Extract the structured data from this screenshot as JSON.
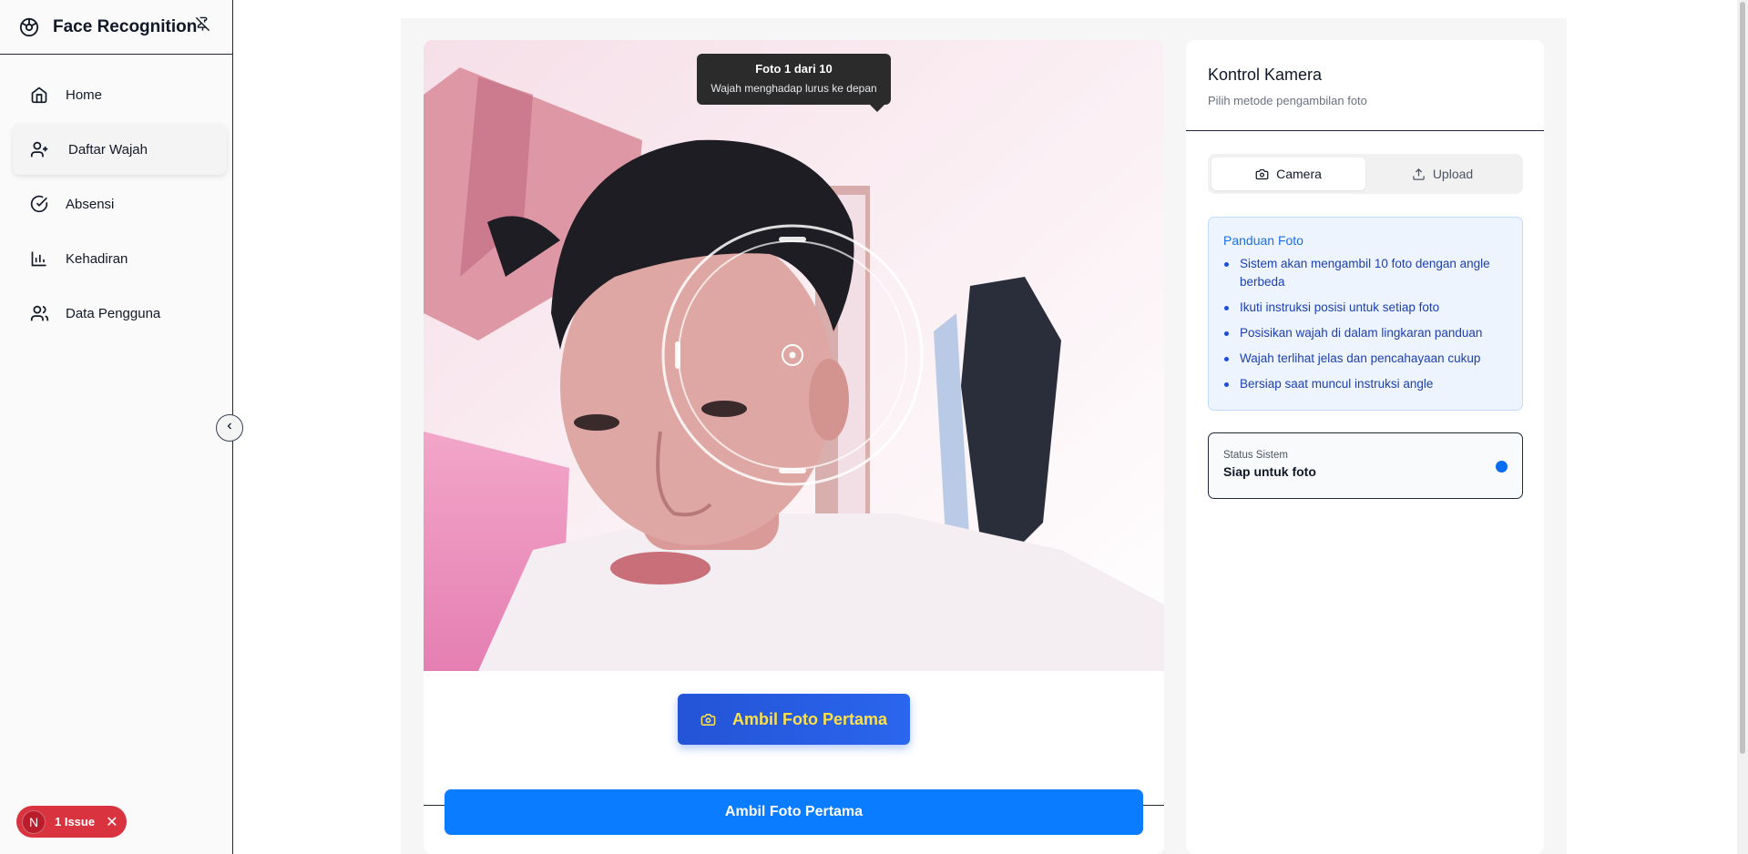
{
  "sidebar": {
    "title": "Face Recognition",
    "items": [
      {
        "label": "Home",
        "icon": "home-icon"
      },
      {
        "label": "Daftar Wajah",
        "icon": "user-plus-icon",
        "active": true
      },
      {
        "label": "Absensi",
        "icon": "check-circle-icon"
      },
      {
        "label": "Kehadiran",
        "icon": "bar-chart-icon"
      },
      {
        "label": "Data Pengguna",
        "icon": "users-icon"
      }
    ]
  },
  "camera": {
    "tooltip_title": "Foto 1 dari 10",
    "tooltip_subtitle": "Wajah menghadap lurus ke depan",
    "capture_label": "Ambil Foto Pertama",
    "primary_label": "Ambil Foto Pertama"
  },
  "control": {
    "title": "Kontrol Kamera",
    "subtitle": "Pilih metode pengambilan foto",
    "tabs": [
      {
        "label": "Camera",
        "icon": "camera-icon",
        "active": true
      },
      {
        "label": "Upload",
        "icon": "upload-icon",
        "active": false
      }
    ],
    "guide": {
      "title": "Panduan Foto",
      "items": [
        "Sistem akan mengambil 10 foto dengan angle berbeda",
        "Ikuti instruksi posisi untuk setiap foto",
        "Posisikan wajah di dalam lingkaran panduan",
        "Wajah terlihat jelas dan pencahayaan cukup",
        "Bersiap saat muncul instruksi angle"
      ]
    },
    "status": {
      "label": "Status Sistem",
      "value": "Siap untuk foto"
    }
  },
  "issues": {
    "badge": "N",
    "label": "1 Issue"
  },
  "colors": {
    "accent": "#0a7cff",
    "capture_gradient_start": "#2453d6",
    "capture_text": "#fde047",
    "status_dot": "#0a6cf0",
    "issue_bg": "#d9333f"
  }
}
